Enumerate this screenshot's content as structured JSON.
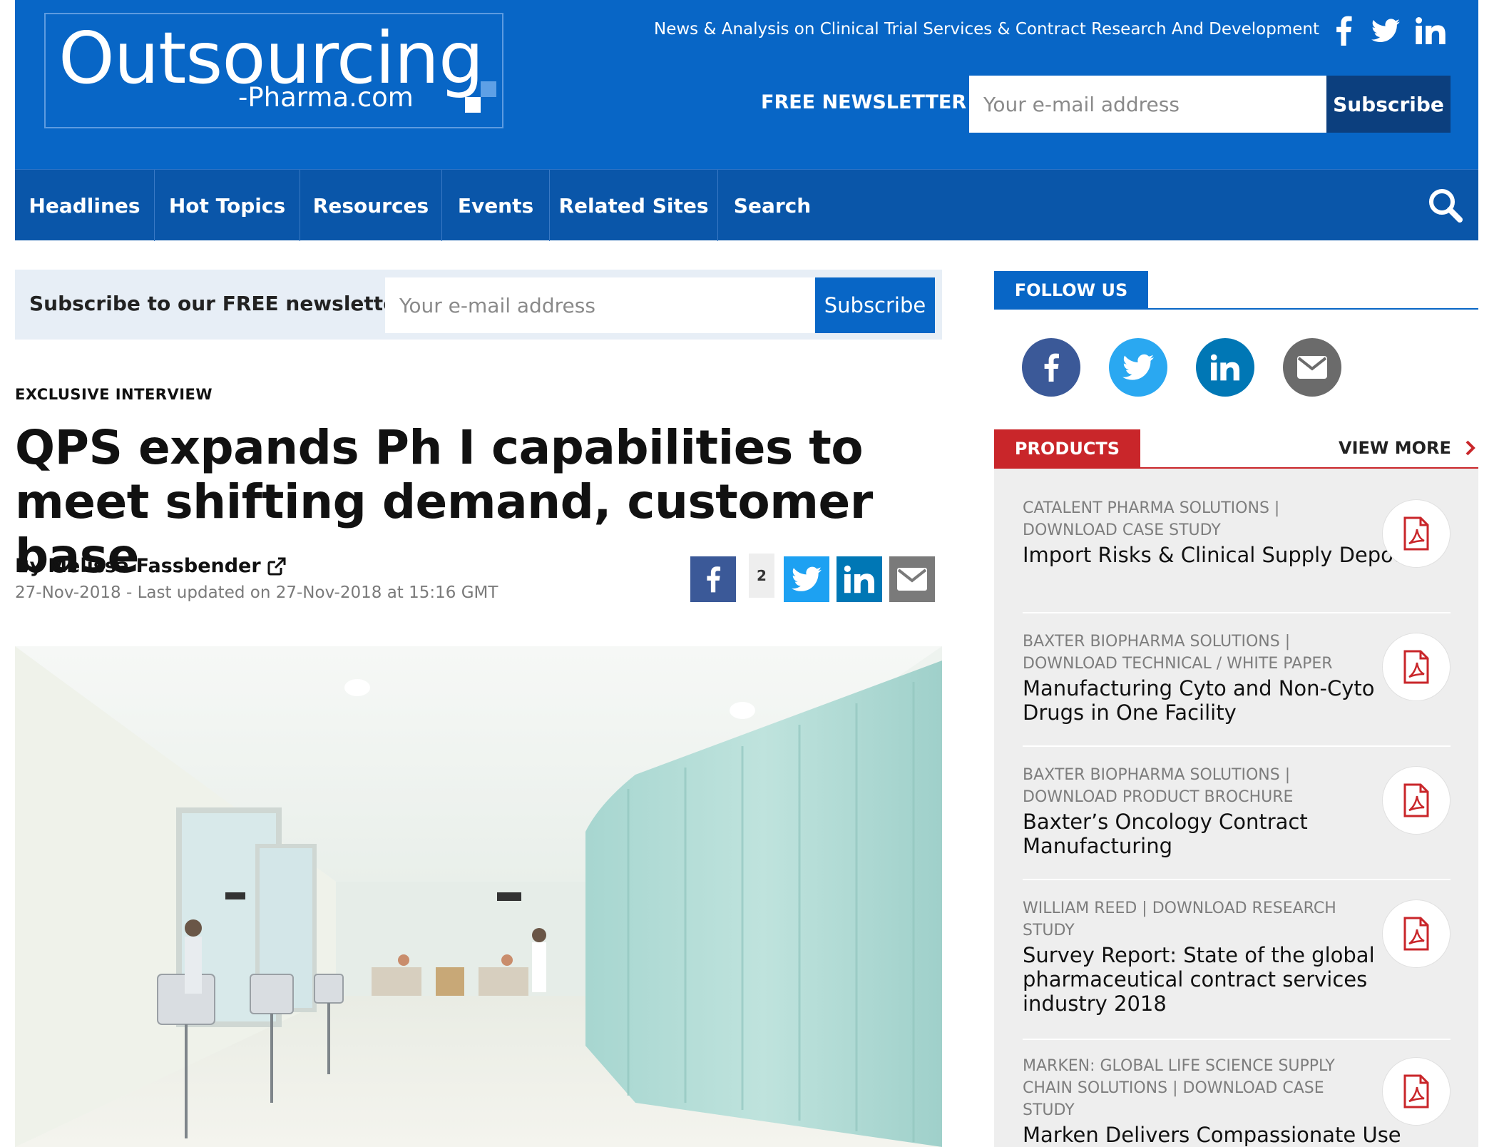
{
  "header": {
    "logo_main": "Outsourcing",
    "logo_sub": "-Pharma.com",
    "tagline": "News & Analysis on Clinical Trial Services & Contract Research And Development",
    "newsletter_label": "FREE NEWSLETTER",
    "email_placeholder": "Your e-mail address",
    "subscribe_label": "Subscribe",
    "social_icons": [
      "facebook-icon",
      "twitter-icon",
      "linkedin-icon"
    ]
  },
  "nav": {
    "items": [
      {
        "label": "Headlines"
      },
      {
        "label": "Hot Topics"
      },
      {
        "label": "Resources"
      },
      {
        "label": "Events"
      },
      {
        "label": "Related Sites"
      },
      {
        "label": "Search"
      }
    ],
    "search_icon": "search-icon"
  },
  "subscribe_bar": {
    "label": "Subscribe to our FREE newsletter",
    "placeholder": "Your e-mail address",
    "button": "Subscribe"
  },
  "article": {
    "kicker": "EXCLUSIVE INTERVIEW",
    "title": "QPS expands Ph I capabilities to meet shifting demand, customer base",
    "by": "By",
    "author": "Melissa Fassbender",
    "date": "27-Nov-2018 - Last updated on 27-Nov-2018 at 15:16 GMT",
    "share_count": "2",
    "share_icons": [
      "facebook-icon",
      "twitter-icon",
      "linkedin-icon",
      "email-icon"
    ]
  },
  "sidebar": {
    "follow_label": "FOLLOW US",
    "follow_icons": [
      "facebook-icon",
      "twitter-icon",
      "linkedin-icon",
      "email-icon"
    ],
    "products_label": "PRODUCTS",
    "view_more": "VIEW MORE",
    "products": [
      {
        "meta": "CATALENT PHARMA SOLUTIONS | DOWNLOAD CASE STUDY",
        "title": "Import Risks & Clinical Supply Depots"
      },
      {
        "meta": "BAXTER BIOPHARMA SOLUTIONS | DOWNLOAD TECHNICAL / WHITE PAPER",
        "title": "Manufacturing Cyto and Non-Cyto Drugs in One Facility"
      },
      {
        "meta": "BAXTER BIOPHARMA SOLUTIONS | DOWNLOAD PRODUCT BROCHURE",
        "title": "Baxter’s Oncology Contract Manufacturing"
      },
      {
        "meta": "WILLIAM REED | DOWNLOAD RESEARCH STUDY",
        "title": "Survey Report: State of the global pharmaceutical contract services industry 2018"
      },
      {
        "meta": "MARKEN: GLOBAL LIFE SCIENCE SUPPLY CHAIN SOLUTIONS | DOWNLOAD CASE STUDY",
        "title": "Marken Delivers Compassionate Use Dose of Emergency Medication to"
      }
    ]
  },
  "colors": {
    "brand_blue": "#0866c6",
    "nav_blue": "#0a56a9",
    "dark_navy": "#0c3f7e",
    "products_red": "#c9262a",
    "facebook": "#3b5998",
    "twitter": "#1da1f2",
    "linkedin": "#0077b5"
  }
}
